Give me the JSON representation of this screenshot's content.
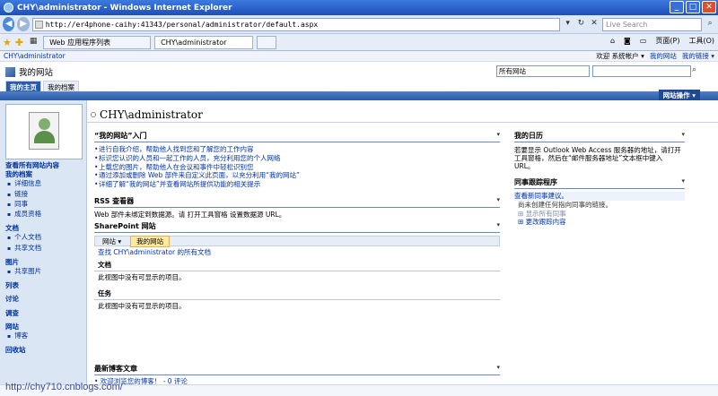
{
  "window": {
    "title": "CHY\\administrator - Windows Internet Explorer",
    "min": "_",
    "max": "□",
    "close": "✕"
  },
  "address": {
    "url": "http://er4phone-caihy:41343/personal/administrator/default.aspx",
    "search_placeholder": "Live Search"
  },
  "tabs": {
    "tab1": "Web 应用程序列表",
    "tab2": "CHY\\administrator"
  },
  "ie_tools": {
    "page": "页面(P)",
    "tools": "工具(O)"
  },
  "global": {
    "breadcrumb": "CHY\\administrator",
    "welcome": "欢迎 系统帐户 ▾",
    "mysite": "我的网站",
    "mylinks": "我的链接 ▾"
  },
  "site": {
    "title": "我的网站",
    "scope": "所有网站",
    "tab_home": "我的主页",
    "tab_profile": "我的档案",
    "site_actions": "网站操作 ▾"
  },
  "leftnav": {
    "items": [
      {
        "t": "h",
        "label": "查看所有网站内容"
      },
      {
        "t": "h",
        "label": "我的档案"
      },
      {
        "t": "i",
        "label": "详细信息"
      },
      {
        "t": "i",
        "label": "链接"
      },
      {
        "t": "i",
        "label": "同事"
      },
      {
        "t": "i",
        "label": "成员资格"
      },
      {
        "t": "h",
        "label": "文档"
      },
      {
        "t": "i",
        "label": "个人文档"
      },
      {
        "t": "i",
        "label": "共享文档"
      },
      {
        "t": "h",
        "label": "图片"
      },
      {
        "t": "i",
        "label": "共享图片"
      },
      {
        "t": "h",
        "label": "列表"
      },
      {
        "t": "h",
        "label": "讨论"
      },
      {
        "t": "h",
        "label": "调查"
      },
      {
        "t": "h",
        "label": "网站"
      },
      {
        "t": "i",
        "label": "博客"
      },
      {
        "t": "h",
        "label": "回收站"
      }
    ]
  },
  "page": {
    "title": "CHY\\administrator"
  },
  "intro": {
    "header": "“我的网站”入门",
    "lines": [
      "进行自我介绍，帮助他人找到您和了解您的工作内容",
      "标识您认识的人员和一起工作的人员，充分利用您的个人网络",
      "上载您的图片，帮助他人在会议和事件中轻松识别您",
      "通过添加或删除 Web 部件来自定义此页面，以充分利用“我的网站”",
      "详细了解“我的网站”并查看网站所提供功能的相关提示"
    ]
  },
  "rss": {
    "header": "RSS 查看器",
    "text": "Web 部件未绑定到数据源。请 打开工具窗格 设置数据源 URL。"
  },
  "spsites": {
    "header": "SharePoint 网站",
    "nav_sites": "网站 ▾",
    "nav_mysite": "我的网站",
    "find": "查找 CHY\\administrator 的所有文档",
    "docs_h": "文档",
    "docs_t": "此视图中没有可显示的项目。",
    "tasks_h": "任务",
    "tasks_t": "此视图中没有可显示的项目。"
  },
  "blog": {
    "header": "最新博客文章",
    "line": "• 欢迎浏览您的博客！ - 0 评论"
  },
  "calendar": {
    "header": "我的日历",
    "text": "若要显示 Outlook Web Access 服务器的地址，请打开工具窗格，然后在“邮件服务器地址”文本框中键入 URL。"
  },
  "colleague": {
    "header": "同事跟踪程序",
    "suggest": "查看新同事建议。",
    "note": "尚未创建任何指向同事的链接。",
    "show_all": "显示所有同事",
    "change": "更改跟踪内容"
  },
  "watermark": "http://chy710.cnblogs.com/",
  "menu_glyph": "▾"
}
